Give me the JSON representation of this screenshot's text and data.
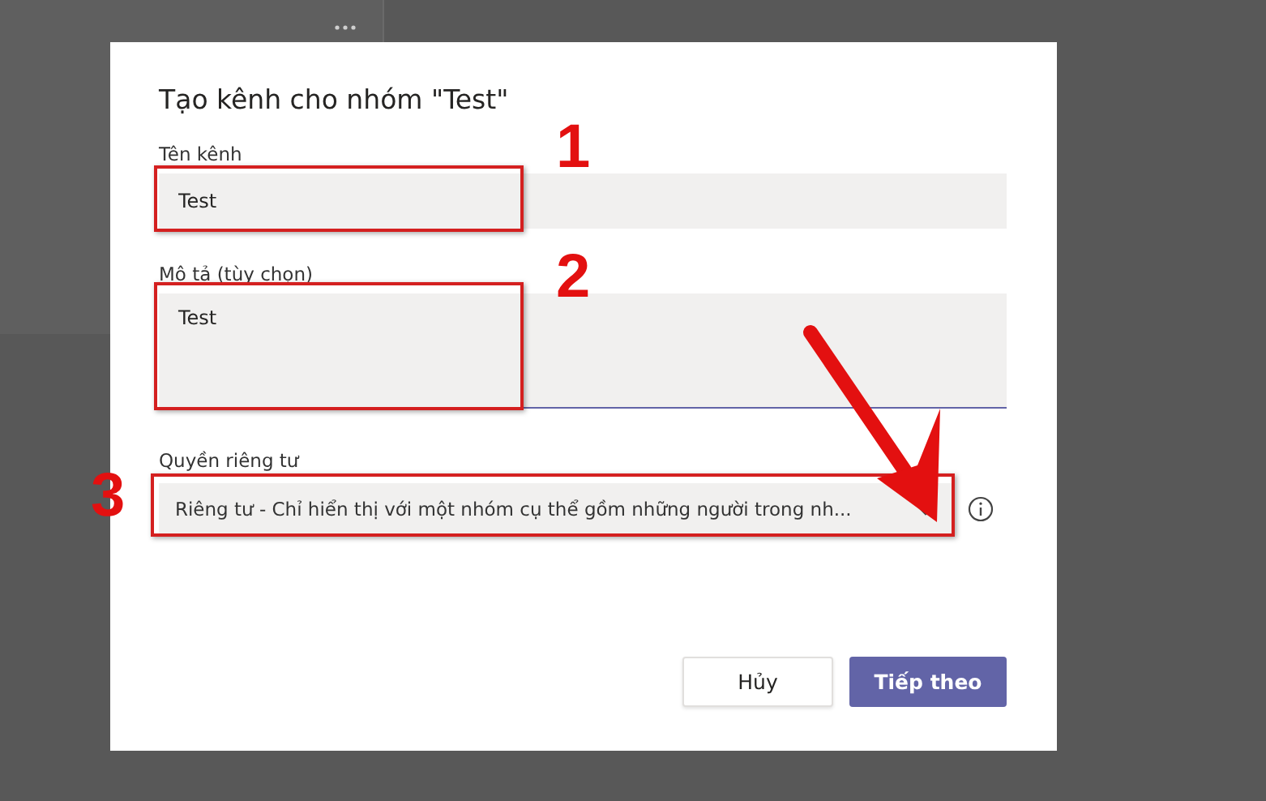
{
  "dialog": {
    "title": "Tạo kênh cho nhóm \"Test\"",
    "fields": [
      {
        "kind": "text",
        "label": "Tên kênh",
        "value": "Test"
      },
      {
        "kind": "textarea",
        "label": "Mô tả (tùy chọn)",
        "value": "Test"
      },
      {
        "kind": "dropdown",
        "label": "Quyền riêng tư",
        "value": "Riêng tư - Chỉ hiển thị với một nhóm cụ thể gồm những người trong nh..."
      }
    ],
    "buttons": [
      {
        "label": "Hủy",
        "kind": "secondary"
      },
      {
        "label": "Tiếp theo",
        "kind": "primary"
      }
    ]
  },
  "annotations": [
    {
      "label": "1"
    },
    {
      "label": "2"
    },
    {
      "label": "3"
    }
  ]
}
